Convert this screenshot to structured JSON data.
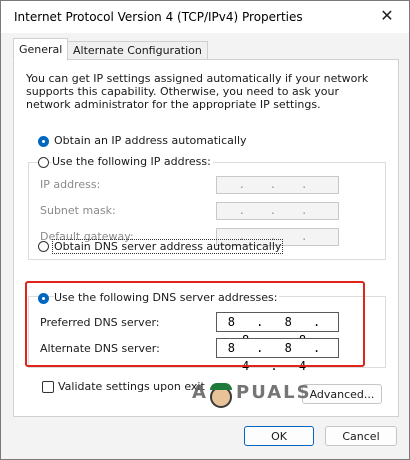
{
  "window": {
    "title": "Internet Protocol Version 4 (TCP/IPv4) Properties",
    "close_glyph": "✕"
  },
  "tabs": [
    {
      "label": "General"
    },
    {
      "label": "Alternate Configuration"
    }
  ],
  "description": "You can get IP settings assigned automatically if your network supports this capability. Otherwise, you need to ask your network administrator for the appropriate IP settings.",
  "ip": {
    "auto_label": "Obtain an IP address automatically",
    "manual_label": "Use the following IP address:",
    "address_label": "IP address:",
    "subnet_label": "Subnet mask:",
    "gateway_label": "Default gateway:",
    "empty_dots": ". . ."
  },
  "dns": {
    "auto_label": "Obtain DNS server address automatically",
    "manual_label": "Use the following DNS server addresses:",
    "preferred_label": "Preferred DNS server:",
    "preferred_value": "8 . 8 . 8 . 8",
    "alternate_label": "Alternate DNS server:",
    "alternate_value": "8 . 8 . 4 . 4"
  },
  "validate_label": "Validate settings upon exit",
  "advanced_label": "Advanced...",
  "ok_label": "OK",
  "cancel_label": "Cancel",
  "watermark": {
    "left": "A",
    "right": "PUALS"
  },
  "colors": {
    "accent": "#0067c0",
    "highlight": "#e0241b"
  }
}
